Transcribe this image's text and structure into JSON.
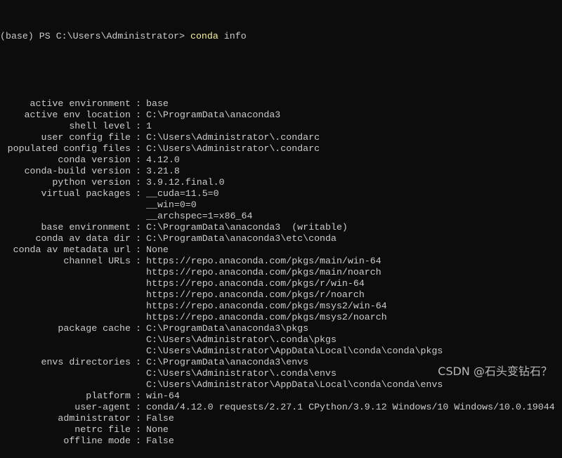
{
  "prompt": {
    "prefix": "(base) PS C:\\Users\\Administrator> ",
    "command": "conda",
    "args": " info"
  },
  "info": [
    {
      "key": "active environment",
      "values": [
        "base"
      ]
    },
    {
      "key": "active env location",
      "values": [
        "C:\\ProgramData\\anaconda3"
      ]
    },
    {
      "key": "shell level",
      "values": [
        "1"
      ]
    },
    {
      "key": "user config file",
      "values": [
        "C:\\Users\\Administrator\\.condarc"
      ]
    },
    {
      "key": "populated config files",
      "values": [
        "C:\\Users\\Administrator\\.condarc"
      ]
    },
    {
      "key": "conda version",
      "values": [
        "4.12.0"
      ]
    },
    {
      "key": "conda-build version",
      "values": [
        "3.21.8"
      ]
    },
    {
      "key": "python version",
      "values": [
        "3.9.12.final.0"
      ]
    },
    {
      "key": "virtual packages",
      "values": [
        "__cuda=11.5=0",
        "__win=0=0",
        "__archspec=1=x86_64"
      ]
    },
    {
      "key": "base environment",
      "values": [
        "C:\\ProgramData\\anaconda3  (writable)"
      ]
    },
    {
      "key": "conda av data dir",
      "values": [
        "C:\\ProgramData\\anaconda3\\etc\\conda"
      ]
    },
    {
      "key": "conda av metadata url",
      "values": [
        "None"
      ]
    },
    {
      "key": "channel URLs",
      "values": [
        "https://repo.anaconda.com/pkgs/main/win-64",
        "https://repo.anaconda.com/pkgs/main/noarch",
        "https://repo.anaconda.com/pkgs/r/win-64",
        "https://repo.anaconda.com/pkgs/r/noarch",
        "https://repo.anaconda.com/pkgs/msys2/win-64",
        "https://repo.anaconda.com/pkgs/msys2/noarch"
      ]
    },
    {
      "key": "package cache",
      "values": [
        "C:\\ProgramData\\anaconda3\\pkgs",
        "C:\\Users\\Administrator\\.conda\\pkgs",
        "C:\\Users\\Administrator\\AppData\\Local\\conda\\conda\\pkgs"
      ]
    },
    {
      "key": "envs directories",
      "values": [
        "C:\\ProgramData\\anaconda3\\envs",
        "C:\\Users\\Administrator\\.conda\\envs",
        "C:\\Users\\Administrator\\AppData\\Local\\conda\\conda\\envs"
      ]
    },
    {
      "key": "platform",
      "values": [
        "win-64"
      ]
    },
    {
      "key": "user-agent",
      "values": [
        "conda/4.12.0 requests/2.27.1 CPython/3.9.12 Windows/10 Windows/10.0.19044"
      ]
    },
    {
      "key": "administrator",
      "values": [
        "False"
      ]
    },
    {
      "key": "netrc file",
      "values": [
        "None"
      ]
    },
    {
      "key": "offline mode",
      "values": [
        "False"
      ]
    }
  ],
  "watermark": "CSDN @石头变钻石？"
}
